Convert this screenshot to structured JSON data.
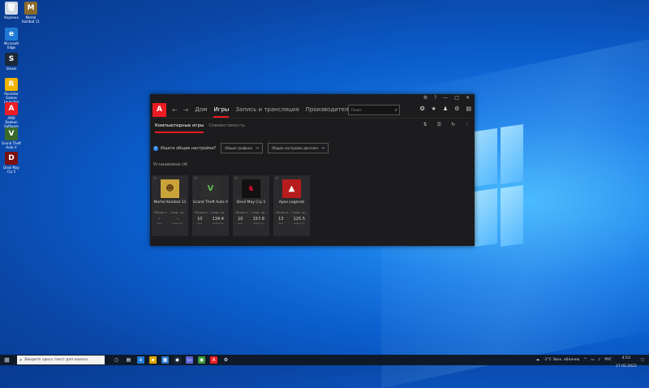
{
  "desktop": {
    "icons": [
      {
        "label": "Корзина",
        "color": "#cfd8e3",
        "glyph": "🗑"
      },
      {
        "label": "Mortal Kombat 11",
        "color": "#8a6a2a",
        "glyph": "M"
      },
      {
        "label": "Microsoft Edge",
        "color": "#1f7ad6",
        "glyph": "e"
      },
      {
        "label": "Steam",
        "color": "#1b2838",
        "glyph": "S"
      },
      {
        "label": "Rockstar Games Launcher",
        "color": "#f0b400",
        "glyph": "R"
      },
      {
        "label": "AMD Radeon Software",
        "color": "#ed1c24",
        "glyph": "A"
      },
      {
        "label": "Grand Theft Auto V",
        "color": "#3a6a2a",
        "glyph": "V"
      },
      {
        "label": "Devil May Cry 5",
        "color": "#7a1010",
        "glyph": "D"
      }
    ]
  },
  "window": {
    "controls": [
      "⚙",
      "?",
      "—",
      "□",
      "✕"
    ]
  },
  "nav": {
    "logo": "A",
    "back": "←",
    "forward": "→",
    "tabs": [
      {
        "label": "Дом"
      },
      {
        "label": "Игры"
      },
      {
        "label": "Запись и трансляция"
      },
      {
        "label": "Производительность"
      }
    ],
    "search_placeholder": "Поиск",
    "right_icons": [
      "bug-icon",
      "star-icon",
      "bell-icon",
      "gear-icon",
      "panel-icon"
    ]
  },
  "subnav": {
    "tabs": [
      {
        "label": "Компьютерные игры"
      },
      {
        "label": "Совместимость"
      }
    ]
  },
  "tips": {
    "question": "Ищете общие настройки?",
    "button1": "Общая графика",
    "button2": "Общие настройки дисплея"
  },
  "installed_label": "Установлено (4)",
  "games": [
    {
      "name": "Mortal Kombat 11",
      "meta": "Общее в... Граф. пр...",
      "stat1": "–",
      "stat1_label": "мин",
      "stat2": "–",
      "stat2_label": "кадр/сек",
      "art_bg": "#c9a23a",
      "art_glyph": "☻",
      "art_fg": "#5a3a10"
    },
    {
      "name": "Grand Theft Auto V",
      "meta": "Общее в... Граф. пр...",
      "stat1": "10",
      "stat1_label": "мин",
      "stat2": "134.4",
      "stat2_label": "кадр/сек",
      "art_bg": "#2e2e2e",
      "art_glyph": "V",
      "art_fg": "#5fbf4f"
    },
    {
      "name": "Devil May Cry 5",
      "meta": "Общее в... Граф. пр...",
      "stat1": "10",
      "stat1_label": "мин",
      "stat2": "157.8",
      "stat2_label": "кадр/сек",
      "art_bg": "#111111",
      "art_glyph": "♞",
      "art_fg": "#c8102e"
    },
    {
      "name": "Apex Legends",
      "meta": "Общее в... Граф. пр...",
      "stat1": "13",
      "stat1_label": "мин",
      "stat2": "125.5",
      "stat2_label": "кадр/сек",
      "art_bg": "#b71c1c",
      "art_glyph": "▲",
      "art_fg": "#ffffff"
    }
  ],
  "taskbar": {
    "search_placeholder": "Введите здесь текст для поиска",
    "weather": "-1°C Звск. облачно",
    "lang": "РУС",
    "time": "4:53",
    "date": "27.02.2022",
    "apps": [
      {
        "glyph": "○",
        "color": "#0e1a2a"
      },
      {
        "glyph": "▤",
        "color": "#0e1a2a"
      },
      {
        "glyph": "e",
        "color": "#1f7ad6"
      },
      {
        "glyph": "▰",
        "color": "#e0a800"
      },
      {
        "glyph": "▦",
        "color": "#2b7bd4"
      },
      {
        "glyph": "◆",
        "color": "#1b2838"
      },
      {
        "glyph": "▭",
        "color": "#5a66d6"
      },
      {
        "glyph": "◉",
        "color": "#3a9a3a"
      },
      {
        "glyph": "A",
        "color": "#ed1c24"
      },
      {
        "glyph": "⚙",
        "color": "#0e1a2a"
      }
    ]
  }
}
